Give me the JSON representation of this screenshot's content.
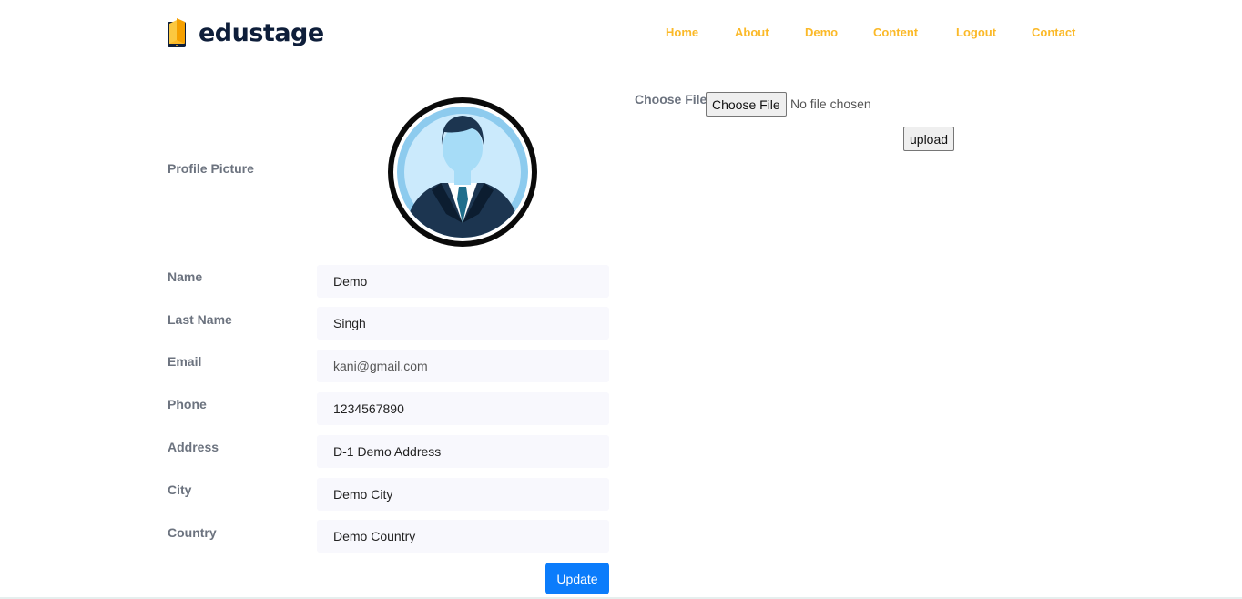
{
  "brand": {
    "name": "edustage",
    "logo_icon": "book-phone-icon"
  },
  "nav": {
    "items": [
      "Home",
      "About",
      "Demo",
      "Content",
      "Logout",
      "Contact"
    ],
    "color": "#fbb928"
  },
  "profile": {
    "picture_label": "Profile Picture",
    "avatar_icon": "user-avatar-icon",
    "fields": [
      {
        "label": "Name",
        "value": "Demo"
      },
      {
        "label": "Last Name",
        "value": "Singh"
      },
      {
        "label": "Email",
        "value": "kani@gmail.com"
      },
      {
        "label": "Phone",
        "value": "1234567890"
      },
      {
        "label": "Address",
        "value": "D-1 Demo Address"
      },
      {
        "label": "City",
        "value": "Demo City"
      },
      {
        "label": "Country",
        "value": "Demo Country"
      }
    ],
    "update_label": "Update",
    "update_color": "#0b7cfb"
  },
  "upload": {
    "label": "Choose File",
    "button_label": "Choose File",
    "status": "No file chosen",
    "submit_label": "upload"
  }
}
